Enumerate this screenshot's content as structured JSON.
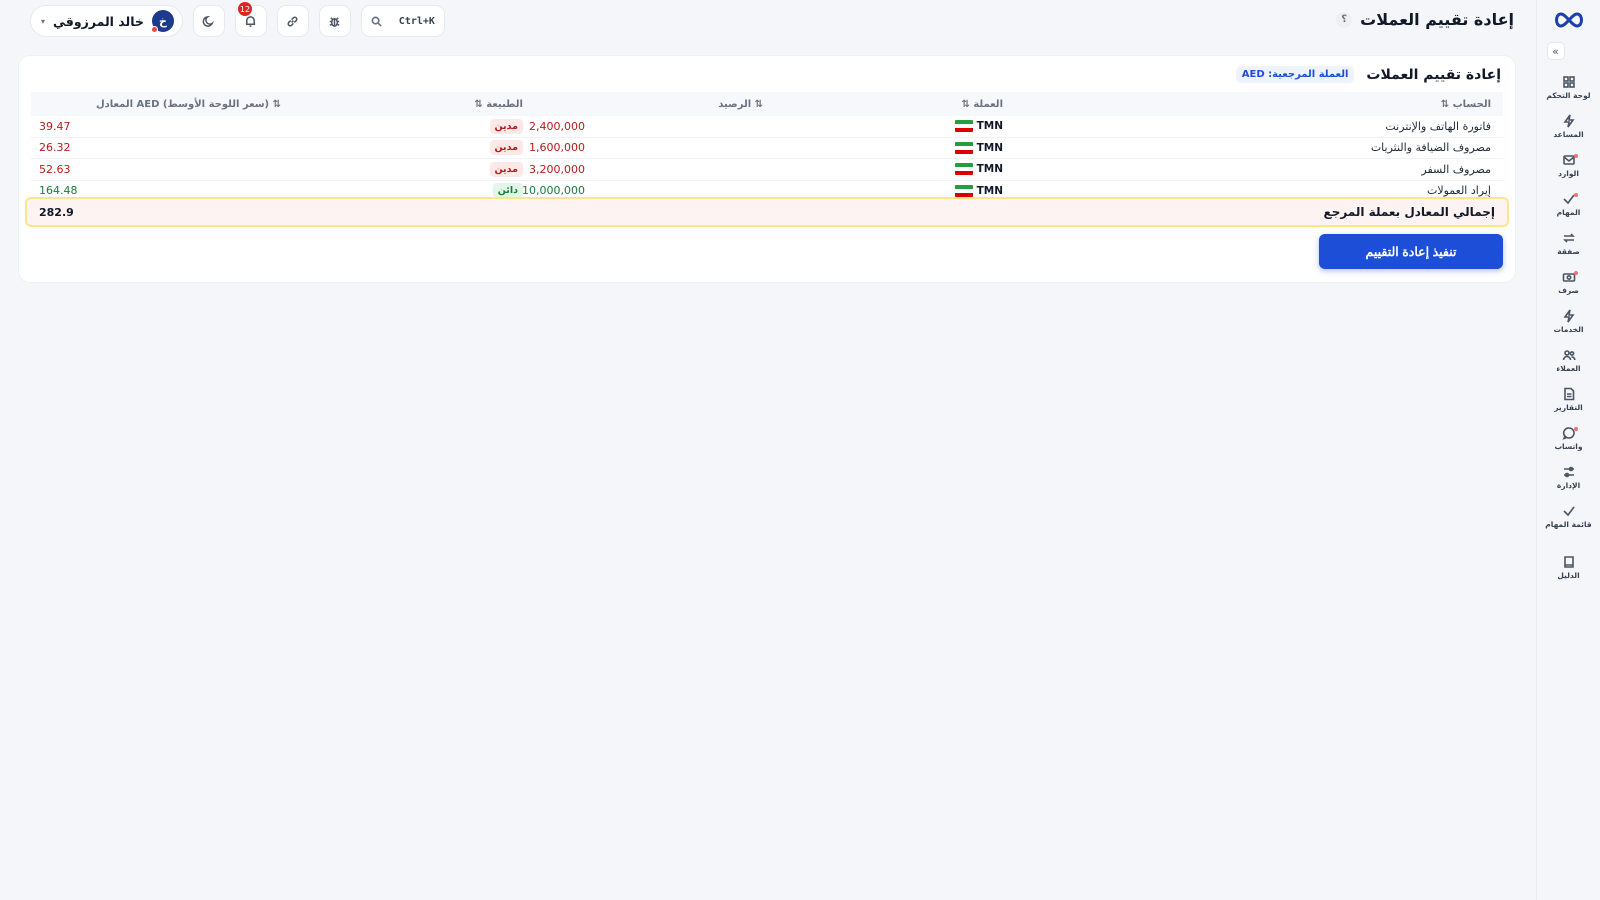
{
  "app": {
    "brand": "logo"
  },
  "sidebar": {
    "items": [
      {
        "label": "لوحة التحكم",
        "icon": "dashboard-icon",
        "dot": false
      },
      {
        "label": "المساعد",
        "icon": "bolt-icon",
        "dot": false
      },
      {
        "label": "الوارد",
        "icon": "inbox-icon",
        "dot": true
      },
      {
        "label": "المهام",
        "icon": "check-icon",
        "dot": true
      },
      {
        "label": "صفقة",
        "icon": "exchange-icon",
        "dot": false
      },
      {
        "label": "صرف",
        "icon": "cash-icon",
        "dot": true
      },
      {
        "label": "الخدمات",
        "icon": "bolt-icon",
        "dot": false
      },
      {
        "label": "العملاء",
        "icon": "users-icon",
        "dot": false
      },
      {
        "label": "التقارير",
        "icon": "report-icon",
        "dot": false
      },
      {
        "label": "واتساب",
        "icon": "chat-icon",
        "dot": true
      },
      {
        "label": "الإدارة",
        "icon": "sliders-icon",
        "dot": false
      },
      {
        "label": "قائمة المهام",
        "icon": "check-icon",
        "dot": false
      }
    ],
    "guide": {
      "label": "الدليل",
      "icon": "book-icon"
    }
  },
  "topbar": {
    "title": "إعادة تقييم العملات",
    "help": "؟",
    "search_shortcut": "Ctrl+K",
    "notifications_count": "12",
    "user": {
      "name": "خالد المرزوقي",
      "initial": "خ"
    }
  },
  "card": {
    "title": "إعادة تقييم العملات",
    "ref_badge": "العملة المرجعية: AED",
    "columns": {
      "account": "الحساب ⇅",
      "currency": "العملة ⇅",
      "balance": "⇅ الرصيد",
      "nature": "الطبيعة ⇅",
      "equivalent": "⇅ (سعر اللوحة الأوسط) AED المعادل"
    },
    "rows": [
      {
        "account": "فاتورة الهاتف والإنترنت",
        "currency": "TMN",
        "balance": "2,400,000",
        "nature": "مدين",
        "equivalent": "39.47"
      },
      {
        "account": "مصروف الضيافة والنثريات",
        "currency": "TMN",
        "balance": "1,600,000",
        "nature": "مدين",
        "equivalent": "26.32"
      },
      {
        "account": "مصروف السفر",
        "currency": "TMN",
        "balance": "3,200,000",
        "nature": "مدين",
        "equivalent": "52.63"
      },
      {
        "account": "إيراد العمولات",
        "currency": "TMN",
        "balance": "10,000,000",
        "nature": "دائن",
        "equivalent": "164.48"
      }
    ],
    "total_label": "إجمالي المعادل بعملة المرجع",
    "total_value": "282.9",
    "execute_button": "تنفيذ إعادة التقييم"
  },
  "colors": {
    "accent": "#1d4ed8",
    "debit": "#b91c1c",
    "credit": "#15803d",
    "total_border": "#fde68a"
  }
}
